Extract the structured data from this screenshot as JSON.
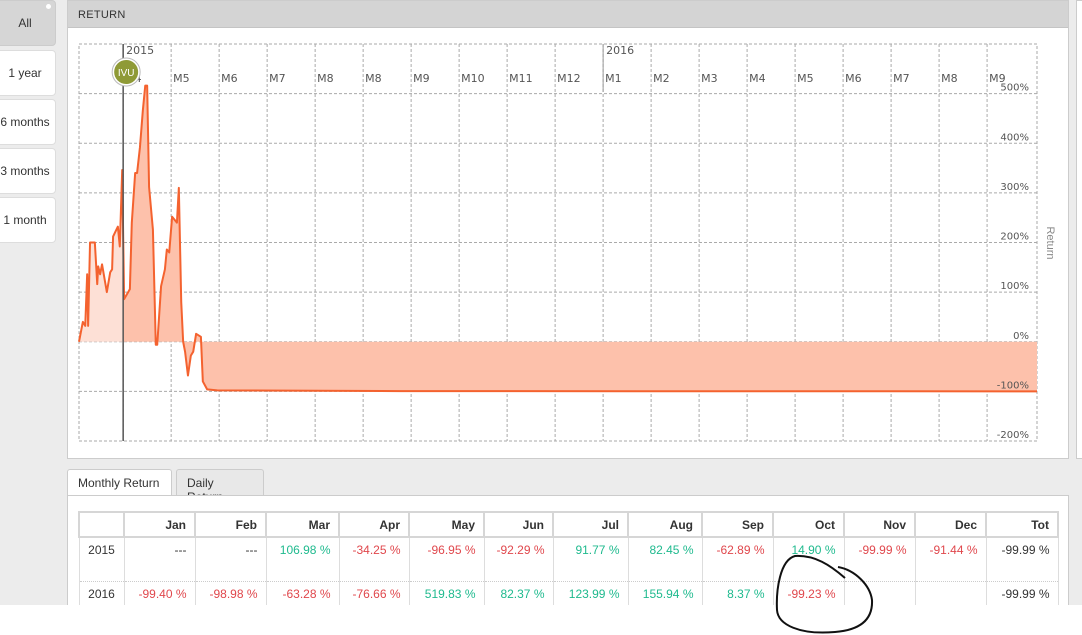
{
  "range_buttons": [
    "All",
    "1 year",
    "6 months",
    "3 months",
    "1 month"
  ],
  "panel_title": "RETURN",
  "tabs": [
    "Monthly Return",
    "Daily Return"
  ],
  "table": {
    "headers": [
      "",
      "Jan",
      "Feb",
      "Mar",
      "Apr",
      "May",
      "Jun",
      "Jul",
      "Aug",
      "Sep",
      "Oct",
      "Nov",
      "Dec",
      "Tot"
    ],
    "rows": [
      {
        "year": "2015",
        "cells": [
          "---",
          "---",
          "106.98 %",
          "-34.25 %",
          "-96.95 %",
          "-92.29 %",
          "91.77 %",
          "82.45 %",
          "-62.89 %",
          "14.90 %",
          "-99.99 %",
          "-91.44 %",
          "-99.99 %"
        ]
      },
      {
        "year": "2016",
        "cells": [
          "-99.40 %",
          "-98.98 %",
          "-63.28 %",
          "-76.66 %",
          "519.83 %",
          "82.37 %",
          "123.99 %",
          "155.94 %",
          "8.37 %",
          "-99.23 %",
          "",
          "",
          "-99.99 %"
        ]
      }
    ]
  },
  "colors": {
    "line": "#f4622f",
    "fill_before": "#fde0d6",
    "fill_after": "#fdc1ab",
    "positive": "#1fba8e",
    "negative": "#e0474c",
    "marker": "#8f9a36"
  },
  "chart_data": {
    "type": "area",
    "ylabel": "Return",
    "ylim": [
      -200,
      600
    ],
    "yticks": [
      -200,
      -100,
      0,
      100,
      200,
      300,
      400,
      500
    ],
    "ytick_labels": [
      "-200%",
      "-100%",
      "0%",
      "100%",
      "200%",
      "300%",
      "400%",
      "500%"
    ],
    "xlim": [
      0,
      19.96
    ],
    "year_labels": [
      {
        "label": "2015",
        "x": 0.92
      },
      {
        "label": "2016",
        "x": 10.92
      }
    ],
    "month_labels": [
      "M4",
      "M5",
      "M6",
      "M7",
      "M8",
      "M8",
      "M9",
      "M10",
      "M11",
      "M12",
      "M1",
      "M2",
      "M3",
      "M4",
      "M5",
      "M6",
      "M7",
      "M8",
      "M9"
    ],
    "marker": {
      "label": "IVU",
      "x": 0.92
    },
    "x_units": "months from chart start",
    "points": [
      [
        0,
        0
      ],
      [
        0.08,
        40
      ],
      [
        0.13,
        32
      ],
      [
        0.17,
        136
      ],
      [
        0.19,
        32
      ],
      [
        0.23,
        200
      ],
      [
        0.33,
        200
      ],
      [
        0.38,
        116
      ],
      [
        0.4,
        152
      ],
      [
        0.44,
        136
      ],
      [
        0.48,
        156
      ],
      [
        0.58,
        100
      ],
      [
        0.65,
        140
      ],
      [
        0.69,
        146
      ],
      [
        0.71,
        212
      ],
      [
        0.81,
        232
      ],
      [
        0.85,
        192
      ],
      [
        0.9,
        346
      ],
      [
        0.94,
        86
      ],
      [
        1.06,
        106
      ],
      [
        1.1,
        240
      ],
      [
        1.17,
        340
      ],
      [
        1.21,
        340
      ],
      [
        1.27,
        392
      ],
      [
        1.33,
        466
      ],
      [
        1.38,
        516
      ],
      [
        1.42,
        516
      ],
      [
        1.46,
        312
      ],
      [
        1.54,
        226
      ],
      [
        1.6,
        -6
      ],
      [
        1.63,
        -6
      ],
      [
        1.71,
        112
      ],
      [
        1.79,
        146
      ],
      [
        1.83,
        186
      ],
      [
        1.88,
        180
      ],
      [
        1.94,
        252
      ],
      [
        2.04,
        240
      ],
      [
        2.08,
        310
      ],
      [
        2.13,
        80
      ],
      [
        2.17,
        0
      ],
      [
        2.21,
        -20
      ],
      [
        2.27,
        -68
      ],
      [
        2.33,
        -28
      ],
      [
        2.38,
        -20
      ],
      [
        2.44,
        16
      ],
      [
        2.54,
        10
      ],
      [
        2.58,
        -80
      ],
      [
        2.67,
        -96
      ],
      [
        2.88,
        -98
      ],
      [
        6.7,
        -99.5
      ],
      [
        19.96,
        -99.9
      ]
    ]
  }
}
